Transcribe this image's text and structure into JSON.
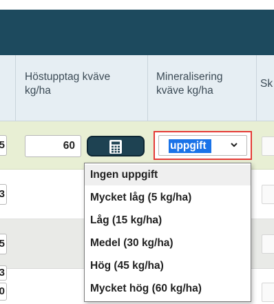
{
  "table": {
    "columns": [
      {
        "label": "Höstupptag kväve\nkg/ha"
      },
      {
        "label": "Mineralisering\nkväve kg/ha"
      },
      {
        "label": "Sk"
      }
    ],
    "rows": [
      {
        "stub": "5",
        "value": "60"
      },
      {
        "stub": "3"
      },
      {
        "stub": "5"
      },
      {
        "stub": "3"
      },
      {
        "stub": "0"
      }
    ]
  },
  "calculator_button": {
    "icon": "calculator-icon"
  },
  "mineralisering_select": {
    "selected_visible": "uppgift",
    "options": [
      "Ingen uppgift",
      "Mycket låg (5 kg/ha)",
      "Låg (15 kg/ha)",
      "Medel (30 kg/ha)",
      "Hög (45 kg/ha)",
      "Mycket hög (60 kg/ha)"
    ]
  },
  "colors": {
    "banner": "#1d4a5e",
    "header_bg": "#e6eef3",
    "active_row": "#e8efd4",
    "focus_border": "#e53935",
    "selection": "#1a73e8"
  }
}
